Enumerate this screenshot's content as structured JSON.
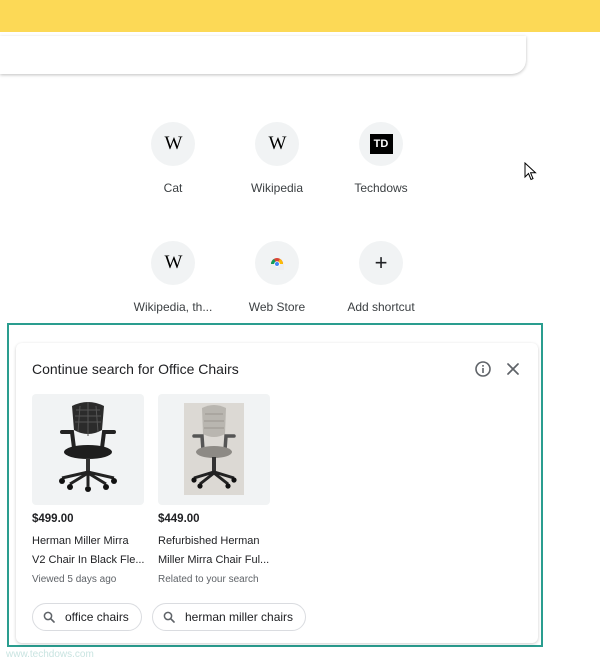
{
  "shortcuts": [
    {
      "label": "Cat",
      "icon": "wikipedia-icon"
    },
    {
      "label": "Wikipedia",
      "icon": "wikipedia-icon"
    },
    {
      "label": "Techdows",
      "icon": "techdows-icon",
      "logo_text": "TD"
    },
    {
      "label": "Wikipedia, th...",
      "icon": "wikipedia-icon"
    },
    {
      "label": "Web Store",
      "icon": "chrome-web-store-icon"
    },
    {
      "label": "Add shortcut",
      "icon": "plus-icon"
    }
  ],
  "wiki_glyph": "W",
  "plus_glyph": "+",
  "card": {
    "title": "Continue search for Office Chairs",
    "products": [
      {
        "price": "$499.00",
        "name_line1": "Herman Miller Mirra",
        "name_line2": "V2 Chair In Black Fle...",
        "meta": "Viewed 5 days ago"
      },
      {
        "price": "$449.00",
        "name_line1": "Refurbished Herman",
        "name_line2": "Miller Mirra Chair Ful...",
        "meta": "Related to your search"
      }
    ],
    "related_searches": [
      "office chairs",
      "herman miller chairs"
    ]
  },
  "colors": {
    "top_bar": "#fcd956",
    "highlight_border": "#2a9d8f"
  },
  "watermark": "www.techdows.com"
}
